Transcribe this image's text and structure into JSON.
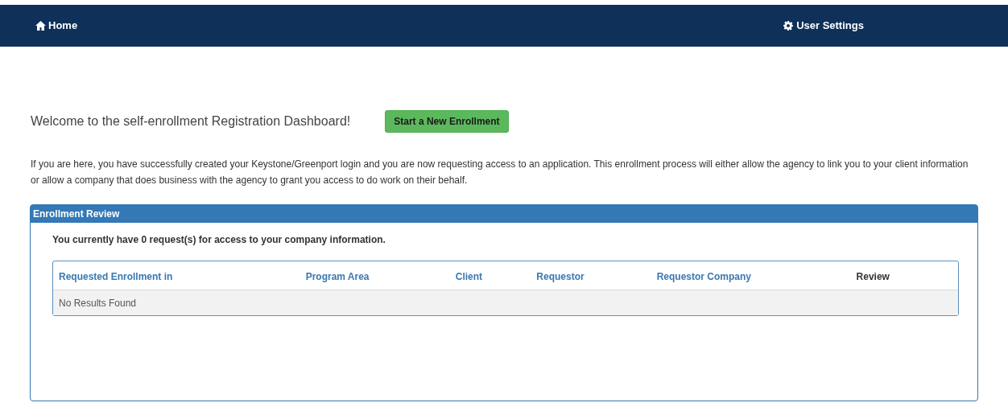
{
  "nav": {
    "home": "Home",
    "settings": "User Settings"
  },
  "welcome": "Welcome to the self-enrollment Registration Dashboard!",
  "start_button": "Start a New Enrollment",
  "intro": "If you are here, you have successfully created your Keystone/Greenport login and you are now requesting access to an application. This enrollment process will either allow the agency to link you to your client information or allow a company that does business with the agency to grant you access to do work on their behalf.",
  "panel": {
    "title": "Enrollment Review",
    "summary": "You currently have 0 request(s) for access to your company information.",
    "table": {
      "columns": [
        {
          "label": "Requested Enrollment in",
          "kind": "link"
        },
        {
          "label": "Program Area",
          "kind": "link"
        },
        {
          "label": "Client",
          "kind": "link"
        },
        {
          "label": "Requestor",
          "kind": "link"
        },
        {
          "label": "Requestor Company",
          "kind": "link"
        },
        {
          "label": "Review",
          "kind": "text"
        }
      ],
      "empty": "No Results Found"
    }
  }
}
